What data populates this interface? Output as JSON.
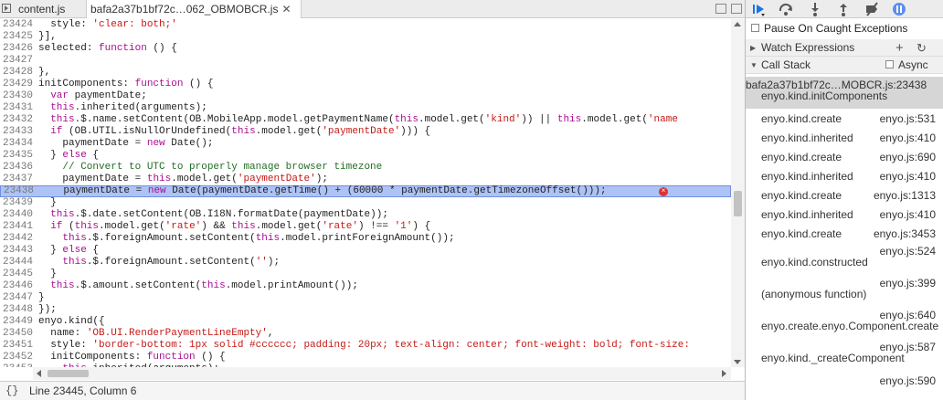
{
  "tabs": [
    {
      "label": "content.js",
      "active": false
    },
    {
      "label": "bafa2a37b1bf72c…062_OBMOBCR.js",
      "active": true
    }
  ],
  "tab_close_glyph": "✕",
  "code_lines": [
    {
      "num": "23424",
      "text": "  style: 'clear: both;'"
    },
    {
      "num": "23425",
      "text": "}],"
    },
    {
      "num": "23426",
      "text": "selected: function () {"
    },
    {
      "num": "23427",
      "text": ""
    },
    {
      "num": "23428",
      "text": "},"
    },
    {
      "num": "23429",
      "text": "initComponents: function () {"
    },
    {
      "num": "23430",
      "text": "  var paymentDate;"
    },
    {
      "num": "23431",
      "text": "  this.inherited(arguments);"
    },
    {
      "num": "23432",
      "text": "  this.$.name.setContent(OB.MobileApp.model.getPaymentName(this.model.get('kind')) || this.model.get('name"
    },
    {
      "num": "23433",
      "text": "  if (OB.UTIL.isNullOrUndefined(this.model.get('paymentDate'))) {"
    },
    {
      "num": "23434",
      "text": "    paymentDate = new Date();"
    },
    {
      "num": "23435",
      "text": "  } else {"
    },
    {
      "num": "23436",
      "text": "    // Convert to UTC to properly manage browser timezone"
    },
    {
      "num": "23437",
      "text": "    paymentDate = this.model.get('paymentDate');"
    },
    {
      "num": "23438",
      "text": "    paymentDate = new Date(paymentDate.getTime() + (60000 * paymentDate.getTimezoneOffset()));",
      "highlight": true,
      "error": true
    },
    {
      "num": "23439",
      "text": "  }"
    },
    {
      "num": "23440",
      "text": "  this.$.date.setContent(OB.I18N.formatDate(paymentDate));"
    },
    {
      "num": "23441",
      "text": "  if (this.model.get('rate') && this.model.get('rate') !== '1') {"
    },
    {
      "num": "23442",
      "text": "    this.$.foreignAmount.setContent(this.model.printForeignAmount());"
    },
    {
      "num": "23443",
      "text": "  } else {"
    },
    {
      "num": "23444",
      "text": "    this.$.foreignAmount.setContent('');"
    },
    {
      "num": "23445",
      "text": "  }"
    },
    {
      "num": "23446",
      "text": "  this.$.amount.setContent(this.model.printAmount());"
    },
    {
      "num": "23447",
      "text": "}"
    },
    {
      "num": "23448",
      "text": "});"
    },
    {
      "num": "23449",
      "text": "enyo.kind({"
    },
    {
      "num": "23450",
      "text": "  name: 'OB.UI.RenderPaymentLineEmpty',"
    },
    {
      "num": "23451",
      "text": "  style: 'border-bottom: 1px solid #cccccc; padding: 20px; text-align: center; font-weight: bold; font-size:"
    },
    {
      "num": "23452",
      "text": "  initComponents: function () {"
    },
    {
      "num": "23453",
      "text": "    this.inherited(arguments);"
    }
  ],
  "status": {
    "brace": "{}",
    "cursor": "Line 23445, Column 6"
  },
  "debugger": {
    "pause_on_caught": "Pause On Caught Exceptions",
    "watch": "Watch Expressions",
    "call_stack": "Call Stack",
    "async": "Async",
    "frames": [
      {
        "loc": "bafa2a37b1bf72c…MOBCR.js:23438",
        "name": "enyo.kind.initComponents",
        "selected": true
      },
      {
        "name": "enyo.kind.create",
        "loc": "enyo.js:531"
      },
      {
        "name": "enyo.kind.inherited",
        "loc": "enyo.js:410"
      },
      {
        "name": "enyo.kind.create",
        "loc": "enyo.js:690"
      },
      {
        "name": "enyo.kind.inherited",
        "loc": "enyo.js:410"
      },
      {
        "name": "enyo.kind.create",
        "loc": "enyo.js:1313"
      },
      {
        "name": "enyo.kind.inherited",
        "loc": "enyo.js:410"
      },
      {
        "name": "enyo.kind.create",
        "loc": "enyo.js:3453"
      },
      {
        "loc": "enyo.js:524",
        "name": "enyo.kind.constructed"
      },
      {
        "name": "(anonymous function)",
        "loc": "enyo.js:399"
      },
      {
        "loc": "enyo.js:640",
        "name": "enyo.create.enyo.Component.create"
      },
      {
        "loc": "enyo.js:587",
        "name": "enyo.kind._createComponent"
      },
      {
        "loc": "enyo.js:590",
        "name": ""
      }
    ]
  },
  "colors": {
    "keyword": "#aa0d91",
    "string": "#c41a16",
    "comment": "#236e25",
    "highlight": "#aec3f5",
    "accent": "#1a73e8"
  },
  "icons": [
    "navigator-icon",
    "split-icon",
    "resume-icon",
    "step-over-icon",
    "step-into-icon",
    "step-out-icon",
    "deactivate-breakpoints-icon",
    "pause-on-exceptions-icon",
    "add-icon",
    "refresh-icon",
    "error-icon"
  ]
}
